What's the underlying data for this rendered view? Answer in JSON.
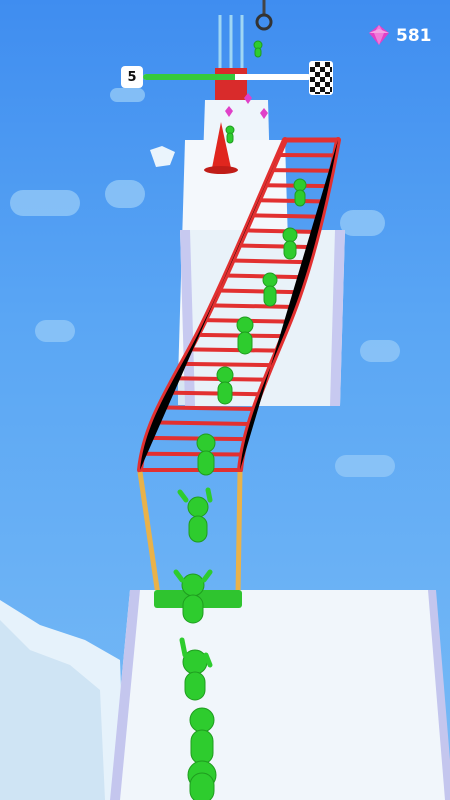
{
  "hud": {
    "level": "5",
    "progress": 0.55,
    "gem_count": "581",
    "progress_color": "#36c93c",
    "gem_color": "#e040c8"
  },
  "scene": {
    "ladder_color": "#e23030",
    "stickman_color": "#2ecc2e",
    "track_color": "#f2f7fb",
    "cone_color": "#e0261e"
  }
}
